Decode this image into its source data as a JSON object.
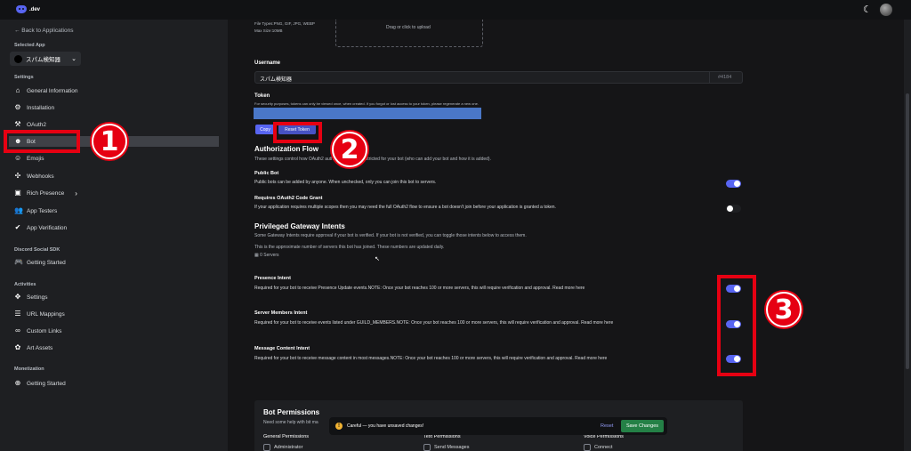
{
  "topbar": {
    "logo_text": ".dev",
    "moon_icon": "☾"
  },
  "sidebar": {
    "back_label": "← Back to Applications",
    "selected_app_label": "Selected App",
    "app_name": "スパム検知器",
    "settings_label": "Settings",
    "settings_items": [
      {
        "label": "General Information",
        "icon": "home-icon"
      },
      {
        "label": "Installation",
        "icon": "gear-icon"
      },
      {
        "label": "OAuth2",
        "icon": "wrench-icon"
      },
      {
        "label": "Bot",
        "icon": "bot-icon"
      },
      {
        "label": "Emojis",
        "icon": "emoji-icon"
      },
      {
        "label": "Webhooks",
        "icon": "webhook-icon"
      },
      {
        "label": "Rich Presence",
        "icon": "image-icon"
      },
      {
        "label": "App Testers",
        "icon": "users-icon"
      },
      {
        "label": "App Verification",
        "icon": "check-icon"
      }
    ],
    "social_sdk_label": "Discord Social SDK",
    "sdk_items": [
      {
        "label": "Getting Started",
        "icon": "gamepad-icon"
      }
    ],
    "activities_label": "Activities",
    "activities_items": [
      {
        "label": "Settings",
        "icon": "puzzle-icon"
      },
      {
        "label": "URL Mappings",
        "icon": "list-icon"
      },
      {
        "label": "Custom Links",
        "icon": "link-icon"
      },
      {
        "label": "Art Assets",
        "icon": "art-icon"
      }
    ],
    "monetization_label": "Monetization",
    "monetization_items": [
      {
        "label": "Getting Started",
        "icon": "plus-circle-icon"
      }
    ]
  },
  "main": {
    "file_types": "File Types:PNG, GIF, JPG, WEBP",
    "max_size": "Max Size:10MB",
    "upload_text": "Drag or click to upload",
    "username_label": "Username",
    "username_value": "スパム検知器",
    "discriminator": "#4184",
    "token_label": "Token",
    "token_note": "For security purposes, tokens can only be viewed once, when created. If you forgot or lost access to your token, please regenerate a new one.",
    "copy_btn": "Copy",
    "reset_token_btn": "Reset Token",
    "auth_flow_title": "Authorization Flow",
    "auth_flow_desc": "These settings control how OAuth2 authorizations are restricted for your bot (who can add your bot and how it is added).",
    "public_bot_label": "Public Bot",
    "public_bot_desc": "Public bots can be added by anyone. When unchecked, only you can join this bot to servers.",
    "requires_code_label": "Requires OAuth2 Code Grant",
    "requires_code_desc": "If your application requires multiple scopes then you may need the full OAuth2 flow to ensure a bot doesn't join before your application is granted a token.",
    "privileged_title": "Privileged Gateway Intents",
    "privileged_desc": "Some Gateway Intents require approval if your bot is verified. If your bot is not verified, you can toggle those intents below to access them.",
    "servers_desc": "This is the approximate number of servers this bot has joined. These numbers are updated daily.",
    "servers_count": "0 Servers",
    "presence_label": "Presence Intent",
    "presence_desc": "Required for your bot to receive Presence Update events.NOTE: Once your bot reaches 100 or more servers, this will require verification and approval. Read more here",
    "members_label": "Server Members Intent",
    "members_desc": "Required for your bot to receive events listed under GUILD_MEMBERS.NOTE: Once your bot reaches 100 or more servers, this will require verification and approval. Read more here",
    "message_label": "Message Content Intent",
    "message_desc": "Required for your bot to receive message content in most messages.NOTE: Once your bot reaches 100 or more servers, this will require verification and approval. Read more here",
    "toggles": {
      "public_bot": true,
      "requires_code": false,
      "presence": true,
      "members": true,
      "message": true
    },
    "bot_permissions_title": "Bot Permissions",
    "bot_permissions_desc": "Need some help with bit ma",
    "general_permissions": "General Permissions",
    "text_permissions": "Text Permissions",
    "voice_permissions": "Voice Permissions",
    "perm_admin": "Administrator",
    "perm_send": "Send Messages",
    "perm_connect": "Connect"
  },
  "toast": {
    "message": "Careful — you have unsaved changes!",
    "reset_btn": "Reset",
    "save_btn": "Save Changes"
  },
  "annotations": {
    "n1": "1",
    "n2": "2",
    "n3": "3"
  },
  "colors": {
    "accent": "#5865f2",
    "save": "#248046",
    "annotation_red": "#e60012",
    "redaction": "#4a77c7"
  }
}
